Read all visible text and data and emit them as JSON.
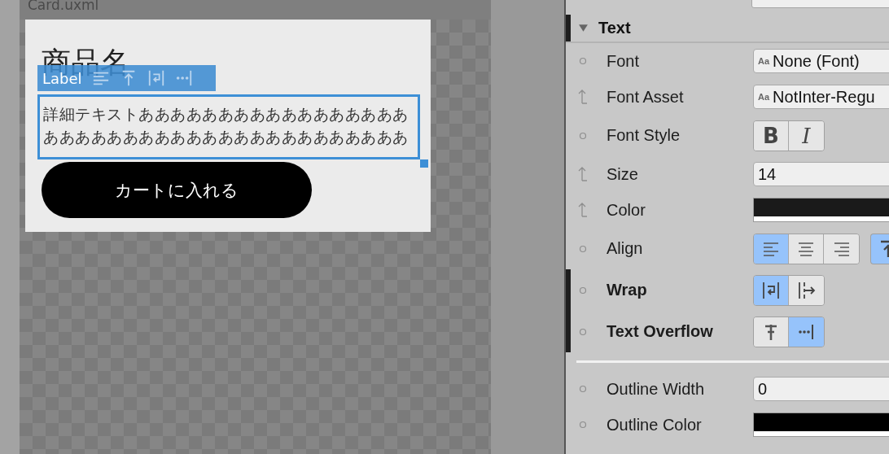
{
  "viewport": {
    "title": "Card.uxml"
  },
  "card": {
    "title": "商品名",
    "description": "詳細テキストああああああああああああああああああああああああああああああああああああああああ",
    "button": "カートに入れる"
  },
  "toolbar": {
    "label": "Label",
    "tools": [
      {
        "kind": "align"
      },
      {
        "kind": "valign"
      },
      {
        "kind": "wrap"
      },
      {
        "kind": "ellipsis"
      }
    ]
  },
  "inspector": {
    "section": {
      "title": "Text",
      "expanded": true
    },
    "rows": [
      {
        "kind": "object",
        "label": "Font",
        "inherited": false,
        "overridden": false,
        "badge": "Aa",
        "value": "None (Font)"
      },
      {
        "kind": "object",
        "label": "Font Asset",
        "inherited": true,
        "overridden": false,
        "badge": "Aa",
        "value": "NotInter-Regu"
      },
      {
        "kind": "toggles",
        "label": "Font Style",
        "inherited": false,
        "overridden": false,
        "options": [
          {
            "kind": "bold",
            "text": "B",
            "selected": false
          },
          {
            "kind": "italic",
            "text": "I",
            "selected": false
          }
        ]
      },
      {
        "kind": "number",
        "label": "Size",
        "inherited": true,
        "overridden": false,
        "value": "14"
      },
      {
        "kind": "color",
        "label": "Color",
        "inherited": true,
        "overridden": false,
        "color": "#1a1a1a"
      },
      {
        "kind": "toggles",
        "label": "Align",
        "inherited": false,
        "overridden": false,
        "options": [
          {
            "kind": "align-left",
            "selected": true
          },
          {
            "kind": "align-center",
            "selected": false
          },
          {
            "kind": "align-right",
            "selected": false
          }
        ],
        "extra": [
          {
            "kind": "valign-top",
            "selected": true
          }
        ]
      },
      {
        "kind": "toggles",
        "label": "Wrap",
        "inherited": false,
        "overridden": true,
        "options": [
          {
            "kind": "wrap",
            "selected": true
          },
          {
            "kind": "nowrap",
            "selected": false
          }
        ]
      },
      {
        "kind": "toggles",
        "label": "Text Overflow",
        "inherited": false,
        "overridden": true,
        "options": [
          {
            "kind": "clip",
            "selected": false
          },
          {
            "kind": "ellipsis",
            "selected": true
          }
        ]
      },
      {
        "kind": "divider"
      },
      {
        "kind": "number",
        "label": "Outline Width",
        "inherited": false,
        "overridden": false,
        "value": "0"
      },
      {
        "kind": "color",
        "label": "Outline Color",
        "inherited": false,
        "overridden": false,
        "color": "#000000"
      }
    ]
  }
}
